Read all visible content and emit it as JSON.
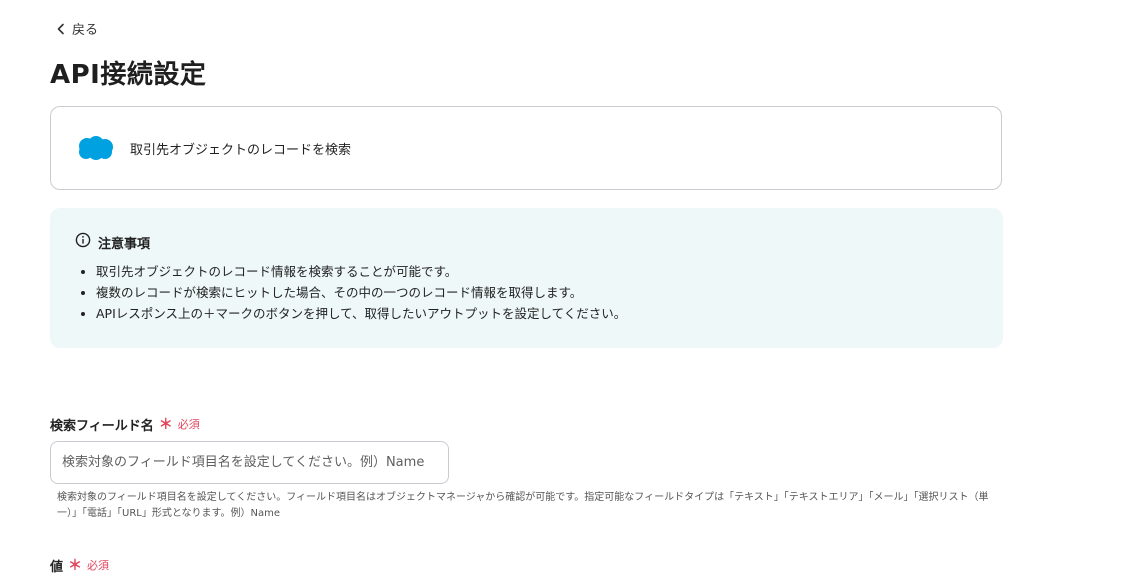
{
  "back": {
    "label": "戻る"
  },
  "page_title": "API接続設定",
  "app_card": {
    "label": "取引先オブジェクトのレコードを検索",
    "logo": "salesforce-cloud-icon",
    "logo_color": "#00a1e0"
  },
  "notice": {
    "title": "注意事項",
    "items": [
      "取引先オブジェクトのレコード情報を検索することが可能です。",
      "複数のレコードが検索にヒットした場合、その中の一つのレコード情報を取得します。",
      "APIレスポンス上の＋マークのボタンを押して、取得したいアウトプットを設定してください。"
    ]
  },
  "fields": {
    "search_field": {
      "label": "検索フィールド名",
      "required_mark": "＊",
      "required_text": "必須",
      "placeholder": "検索対象のフィールド項目名を設定してください。例）Name",
      "value": "",
      "help": "検索対象のフィールド項目名を設定してください。フィールド項目名はオブジェクトマネージャから確認が可能です。指定可能なフィールドタイプは「テキスト」「テキストエリア」「メール」「選択リスト（単一）」「電話」「URL」形式となります。例）Name"
    },
    "value_field": {
      "label": "値",
      "required_mark": "＊",
      "required_text": "必須"
    }
  },
  "colors": {
    "accent_required": "#e0455c",
    "notice_bg": "#eff8f8",
    "border": "#c8ccd1"
  }
}
